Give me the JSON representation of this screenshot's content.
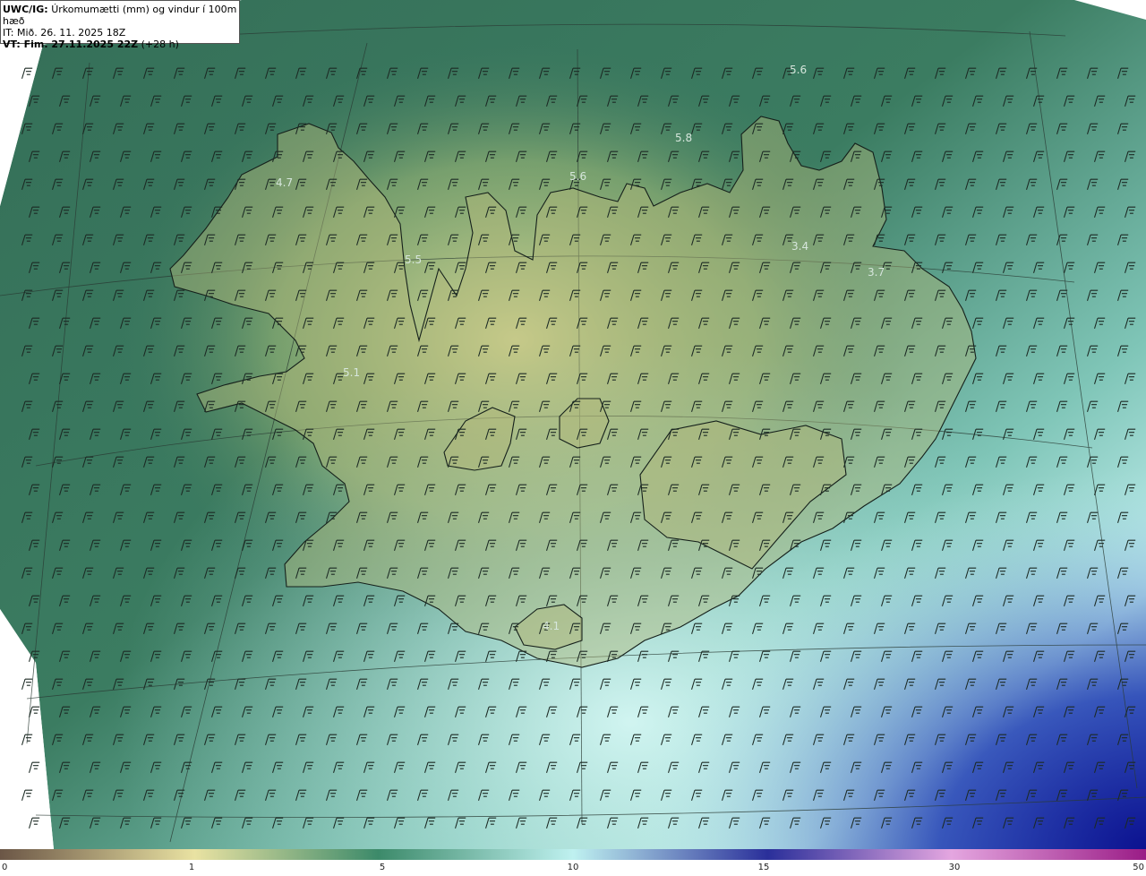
{
  "header": {
    "model": "UWC/IG:",
    "product": "Úrkomumætti (mm) og vindur í 100m hæð",
    "init_time": "IT: Mið. 26. 11. 2025 18Z",
    "valid_time": "VT: Fim. 27.11.2025 22Z",
    "lead": "(+28 h)"
  },
  "map": {
    "land_color": "#3f7a63",
    "value_labels": [
      {
        "text": "5.6"
      },
      {
        "text": "5.8"
      },
      {
        "text": "4.7"
      },
      {
        "text": "5.6"
      },
      {
        "text": "5.5"
      },
      {
        "text": "3.4"
      },
      {
        "text": "3.7"
      },
      {
        "text": "5.1"
      },
      {
        "text": "4.1"
      }
    ]
  },
  "colorbar": {
    "ticks": [
      "0",
      "1",
      "5",
      "10",
      "15",
      "30",
      "50"
    ],
    "colors": [
      "#6b5646",
      "#e9e2a2",
      "#3c8a6a",
      "#bff1f0",
      "#2a2f9a",
      "#e4a6e0",
      "#9a1c86"
    ]
  },
  "icons": [
    "wind-barb-icon"
  ]
}
